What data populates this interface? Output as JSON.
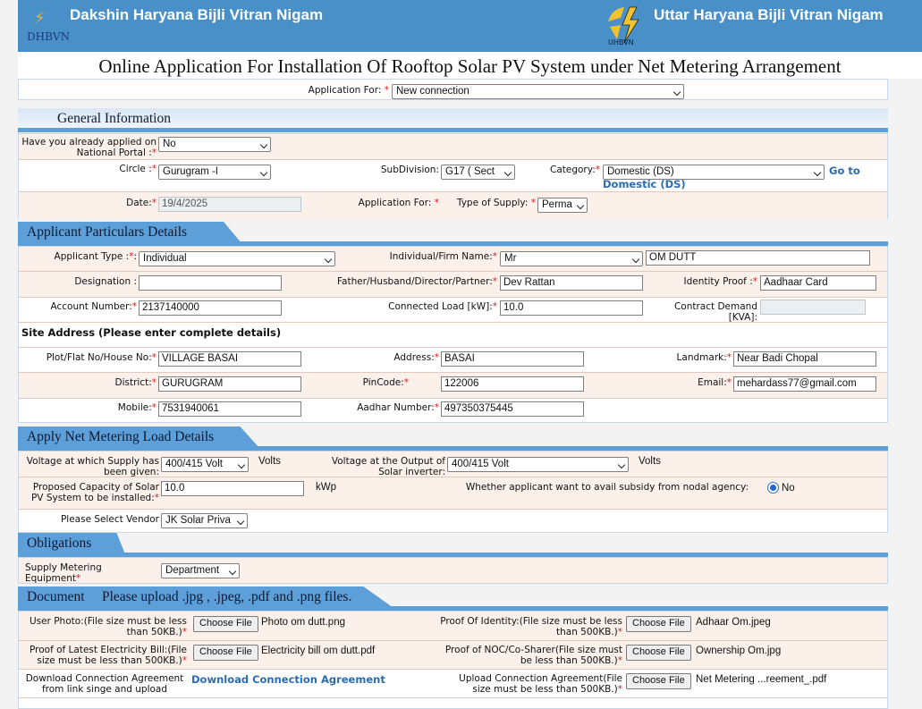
{
  "header": {
    "left_logo_text": "DHBVN",
    "left_title": "Dakshin Haryana Bijli Vitran Nigam",
    "right_logo_text": "UHBVN",
    "right_title": "Uttar Haryana Bijli Vitran Nigam"
  },
  "page_title": "Online Application For Installation Of Rooftop Solar PV System under Net Metering Arrangement",
  "application_for": {
    "label": "Application For:",
    "value": "New connection"
  },
  "general": {
    "title": "General Information",
    "national_portal_label": "Have you already applied on National Portal :",
    "national_portal_value": "No",
    "circle_label": "Circle :",
    "circle_value": "Gurugram -I",
    "subdivision_label": "SubDivision:",
    "subdivision_value": "G17 ( Sect",
    "category_label": "Category:",
    "category_value": "Domestic (DS)",
    "category_link": "Go to Domestic (DS)",
    "date_label": "Date:",
    "date_value": "19/4/2025",
    "app_for_label": "Application For:",
    "supply_label": "Type of Supply:",
    "supply_value": "Perma"
  },
  "applicant": {
    "title": "Applicant Particulars Details",
    "type_label": "Applicant Type :",
    "type_value": "Individual",
    "name_label": "Individual/Firm Name:",
    "salutation": "Mr",
    "name_value": "OM DUTT",
    "designation_label": "Designation :",
    "designation_value": "",
    "father_label": "Father/Husband/Director/Partner:",
    "father_value": "Dev Rattan",
    "identity_label": "Identity Proof :",
    "identity_value": "Aadhaar Card",
    "account_label": "Account Number:",
    "account_value": "2137140000",
    "load_label": "Connected Load [kW]:",
    "load_value": "10.0",
    "demand_label": "Contract Demand [KVA]:",
    "demand_value": "",
    "site_address_heading": "Site Address (Please enter complete details)",
    "plot_label": "Plot/Flat No/House No:",
    "plot_value": "VILLAGE BASAI",
    "address_label": "Address:",
    "address_value": "BASAI",
    "landmark_label": "Landmark:",
    "landmark_value": "Near Badi Chopal",
    "district_label": "District:",
    "district_value": "GURUGRAM",
    "pincode_label": "PinCode:",
    "pincode_value": "122006",
    "email_label": "Email:",
    "email_value": "mehardass77@gmail.com",
    "mobile_label": "Mobile:",
    "mobile_value": "7531940061",
    "aadhar_label": "Aadhar Number:",
    "aadhar_value": "497350375445"
  },
  "netmeter": {
    "title": "Apply Net Metering Load Details",
    "voltage_supply_label": "Voltage at which Supply has been given:",
    "voltage_supply_value": "400/415 Volt",
    "volts1": "Volts",
    "voltage_solar_label": "Voltage at the Output of Solar inverter:",
    "voltage_solar_value": "400/415 Volt",
    "volts2": "Volts",
    "capacity_label": "Proposed Capacity of Solar PV System to be installed:",
    "capacity_value": "10.0",
    "kwp": "kWp",
    "subsidy_label": "Whether applicant want to avail subsidy from nodal agency:",
    "subsidy_value": "No",
    "vendor_label": "Please Select Vendor",
    "vendor_value": "JK Solar Priva"
  },
  "obligations": {
    "title": "Obligations",
    "metering_label": "Supply Metering Equipment",
    "metering_value": "Department"
  },
  "document": {
    "title": "Document",
    "note": "Please upload .jpg , .jpeg, .pdf and .png files.",
    "choose_file": "Choose File",
    "user_photo_label": "User Photo:(File size must be less than 50KB.)",
    "user_photo_file": "Photo om dutt.png",
    "identity_label": "Proof Of Identity:(File size must be less than 500KB.)",
    "identity_file": "Adhaar Om.jpeg",
    "bill_label": "Proof of Latest Electricity Bill:(File size must be less than 500KB.)",
    "bill_file": "Electricity bill om dutt.pdf",
    "noc_label": "Proof of NOC/Co-Sharer(File size must be less than 500KB.)",
    "noc_file": "Ownership Om.jpg",
    "download_label": "Download Connection Agreement from link singe and upload",
    "download_link": "Download Connection Agreement",
    "upload_label": "Upload Connection Agreement(File size must be less than 500KB.)",
    "upload_file": "Net Metering ...reement_.pdf"
  }
}
